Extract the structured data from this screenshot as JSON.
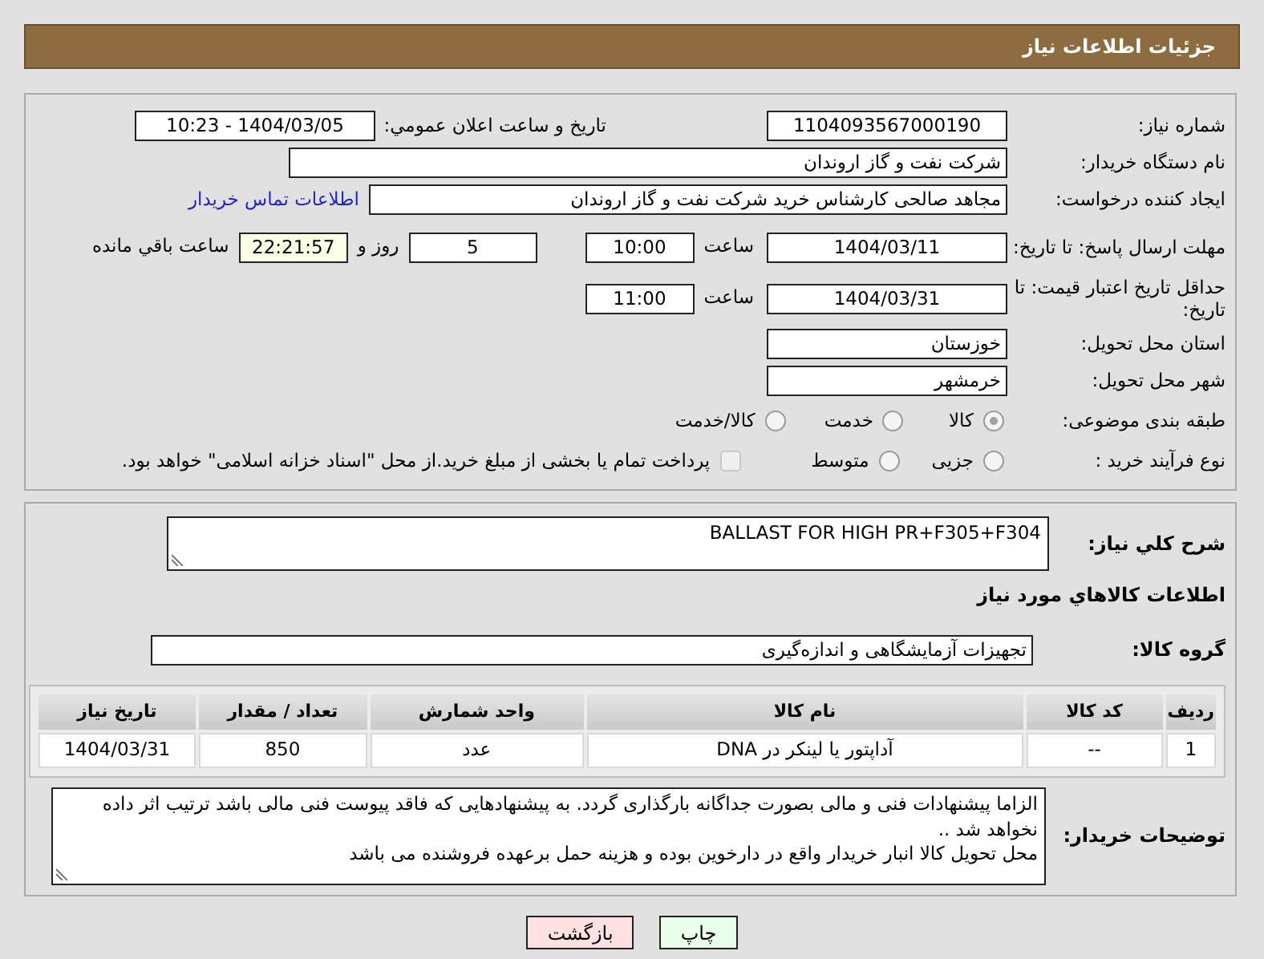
{
  "header": {
    "title": "جزئیات اطلاعات نیاز"
  },
  "need_number": {
    "label": "شماره نیاز:",
    "value": "1104093567000190"
  },
  "announce": {
    "label": "تاریخ و ساعت اعلان عمومي:",
    "value": "1404/03/05 - 10:23"
  },
  "buyer_org": {
    "label": "نام دستگاه خریدار:",
    "value": "شرکت نفت و گاز اروندان"
  },
  "requester": {
    "label": "ایجاد کننده درخواست:",
    "value": "مجاهد صالحی کارشناس خرید شرکت نفت و گاز اروندان",
    "link": "اطلاعات تماس خریدار"
  },
  "deadline": {
    "label": "مهلت ارسال پاسخ: تا تاریخ:",
    "date": "1404/03/11",
    "time_label": "ساعت",
    "time": "10:00",
    "days": "5",
    "days_label": "روز و",
    "remaining": "22:21:57",
    "remaining_label": "ساعت باقي مانده"
  },
  "validity": {
    "label": "حداقل تاریخ اعتبار قیمت: تا تاریخ:",
    "date": "1404/03/31",
    "time_label": "ساعت",
    "time": "11:00"
  },
  "province": {
    "label": "استان محل تحویل:",
    "value": "خوزستان"
  },
  "city": {
    "label": "شهر محل تحویل:",
    "value": "خرمشهر"
  },
  "category": {
    "label": "طبقه بندی موضوعی:",
    "disabled": true,
    "options": [
      {
        "label": "کالا",
        "selected": true
      },
      {
        "label": "خدمت",
        "selected": false
      },
      {
        "label": "کالا/خدمت",
        "selected": false
      }
    ]
  },
  "process": {
    "label": "نوع فرآیند خرید :",
    "disabled": true,
    "options": [
      {
        "label": "جزیی",
        "selected": false
      },
      {
        "label": "متوسط",
        "selected": false
      }
    ],
    "payment": {
      "label": "پرداخت تمام یا بخشی از مبلغ خرید.از محل \"اسناد خزانه اسلامی\" خواهد بود.",
      "checked": false
    }
  },
  "description": {
    "label": "شرح کلي نیاز:",
    "value": "BALLAST FOR HIGH PR+F305+F304"
  },
  "items_title": "اطلاعات کالاهاي مورد نیاز",
  "goods_group": {
    "label": "گروه کالا:",
    "value": "تجهیزات آزمایشگاهی و اندازه‌گیری"
  },
  "table": {
    "columns": [
      "ردیف",
      "کد کالا",
      "نام کالا",
      "واحد شمارش",
      "تعداد / مقدار",
      "تاریخ نیاز"
    ],
    "rows": [
      [
        "1",
        "--",
        "آداپتور یا لینکر در DNA",
        "عدد",
        "850",
        "1404/03/31"
      ]
    ]
  },
  "notes": {
    "label": "توضیحات خریدار:",
    "lines": [
      "الزاما  پیشنهادات فنی و مالی بصورت جداگانه بارگذاری گردد. به پیشنهادهایی که فاقد پیوست فنی مالی باشد ترتیب اثر داده نخواهد شد ..",
      "محل تحویل کالا انبار خریدار واقع در  دارخوین بوده و هزینه حمل برعهده فروشنده می باشد"
    ]
  },
  "buttons": [
    {
      "label": "چاپ",
      "kind": "print"
    },
    {
      "label": "بازگشت",
      "kind": "back"
    }
  ]
}
